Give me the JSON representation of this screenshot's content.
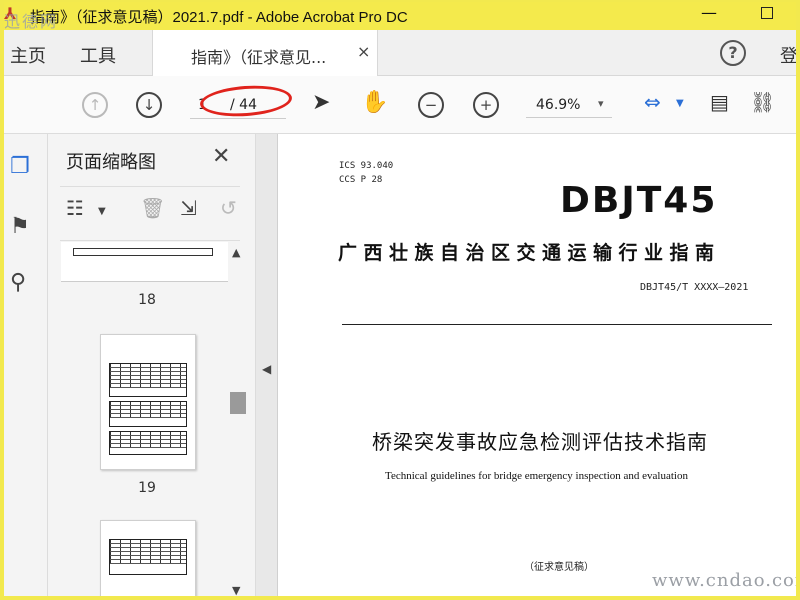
{
  "window": {
    "title": "指南》（征求意见稿）2021.7.pdf - Adobe Acrobat Pro DC",
    "minimize_glyph": "—",
    "app_icon": "acrobat-icon"
  },
  "watermarks": {
    "top_left": "迅德网",
    "bottom_right": "www.cndao.com"
  },
  "tabs": {
    "home": "主页",
    "tools": "工具",
    "document": "指南》（征求意见...",
    "close": "×",
    "help": "?",
    "signin": "登"
  },
  "toolbar": {
    "page_current": "1",
    "page_total": "/ 44",
    "zoom_value": "46.9%",
    "zoom_caret": "▾"
  },
  "thumbnail_panel": {
    "title": "页面缩略图",
    "close": "✕",
    "pages": [
      {
        "label": "18"
      },
      {
        "label": "19"
      }
    ]
  },
  "document": {
    "ics": "ICS  93.040",
    "ccs": "CCS  P  28",
    "code": "DBJT45",
    "organization": "广西壮族自治区交通运输行业指南",
    "number": "DBJT45/T XXXX—2021",
    "title_cn": "桥梁突发事故应急检测评估技术指南",
    "title_en": "Technical guidelines for bridge emergency inspection and evaluation",
    "draft_note": "（征求意见稿）"
  },
  "colors": {
    "titlebar": "#f4ea4c",
    "accent": "#2b6fd6",
    "annotation": "#e0231c"
  }
}
